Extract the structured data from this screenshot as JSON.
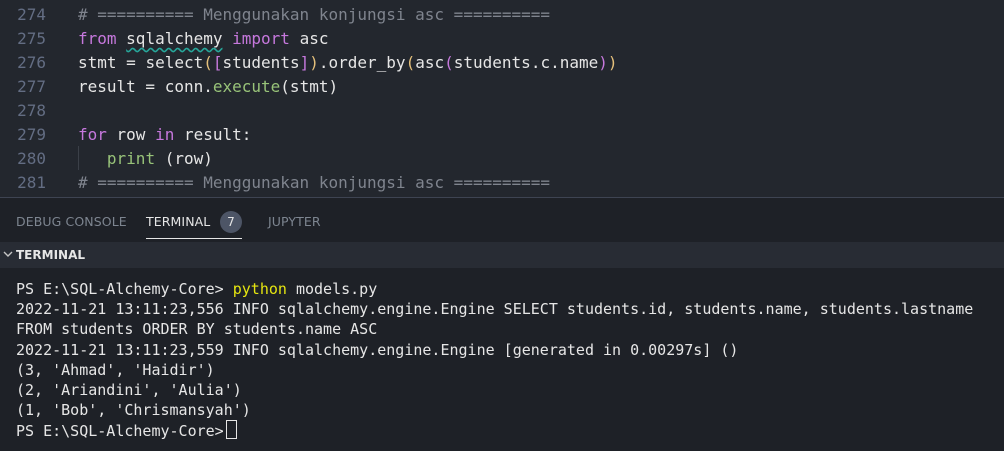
{
  "editor": {
    "lines": [
      {
        "num": "274",
        "tokens": [
          {
            "t": "# ========== Menggunakan konjungsi asc ==========",
            "c": "comment"
          }
        ]
      },
      {
        "num": "275",
        "tokens": [
          {
            "t": "from ",
            "c": "keyword"
          },
          {
            "t": "sqlalchemy",
            "c": "plain squiggle"
          },
          {
            "t": " import ",
            "c": "keyword"
          },
          {
            "t": "asc",
            "c": "plain"
          }
        ]
      },
      {
        "num": "276",
        "tokens": [
          {
            "t": "stmt = ",
            "c": "plain"
          },
          {
            "t": "select",
            "c": "plain"
          },
          {
            "t": "(",
            "c": "bracket"
          },
          {
            "t": "[",
            "c": "bracket2"
          },
          {
            "t": "students",
            "c": "plain"
          },
          {
            "t": "]",
            "c": "bracket2"
          },
          {
            "t": ")",
            "c": "bracket"
          },
          {
            "t": ".order_by",
            "c": "plain"
          },
          {
            "t": "(",
            "c": "bracket"
          },
          {
            "t": "asc",
            "c": "plain"
          },
          {
            "t": "(",
            "c": "bracket2"
          },
          {
            "t": "students.c.name",
            "c": "plain"
          },
          {
            "t": ")",
            "c": "bracket2"
          },
          {
            "t": ")",
            "c": "bracket"
          }
        ]
      },
      {
        "num": "277",
        "tokens": [
          {
            "t": "result = conn.",
            "c": "plain"
          },
          {
            "t": "execute",
            "c": "method"
          },
          {
            "t": "(stmt)",
            "c": "plain"
          }
        ]
      },
      {
        "num": "278",
        "tokens": []
      },
      {
        "num": "279",
        "tokens": [
          {
            "t": "for ",
            "c": "keyword"
          },
          {
            "t": "row ",
            "c": "plain"
          },
          {
            "t": "in ",
            "c": "keyword"
          },
          {
            "t": "result:",
            "c": "plain"
          }
        ]
      },
      {
        "num": "280",
        "tokens": [
          {
            "t": "   ",
            "c": "plain"
          },
          {
            "t": "print",
            "c": "method"
          },
          {
            "t": " (row)",
            "c": "plain"
          }
        ]
      },
      {
        "num": "281",
        "tokens": [
          {
            "t": "# ========== Menggunakan konjungsi asc ==========",
            "c": "comment"
          }
        ]
      }
    ]
  },
  "panel": {
    "tabs": [
      {
        "label": "DEBUG CONSOLE",
        "active": false
      },
      {
        "label": "TERMINAL",
        "active": true
      },
      {
        "label": "JUPYTER",
        "active": false
      }
    ],
    "terminal_badge": "7"
  },
  "terminal": {
    "section_title": "TERMINAL",
    "prompt": "PS E:\\SQL-Alchemy-Core> ",
    "command": "python",
    "command_args": " models.py",
    "output": [
      "2022-11-21 13:11:23,556 INFO sqlalchemy.engine.Engine SELECT students.id, students.name, students.lastname",
      "FROM students ORDER BY students.name ASC",
      "2022-11-21 13:11:23,559 INFO sqlalchemy.engine.Engine [generated in 0.00297s] ()",
      "(3, 'Ahmad', 'Haidir')",
      "(2, 'Ariandini', 'Aulia')",
      "(1, 'Bob', 'Chrismansyah')"
    ],
    "final_prompt": "PS E:\\SQL-Alchemy-Core>"
  }
}
